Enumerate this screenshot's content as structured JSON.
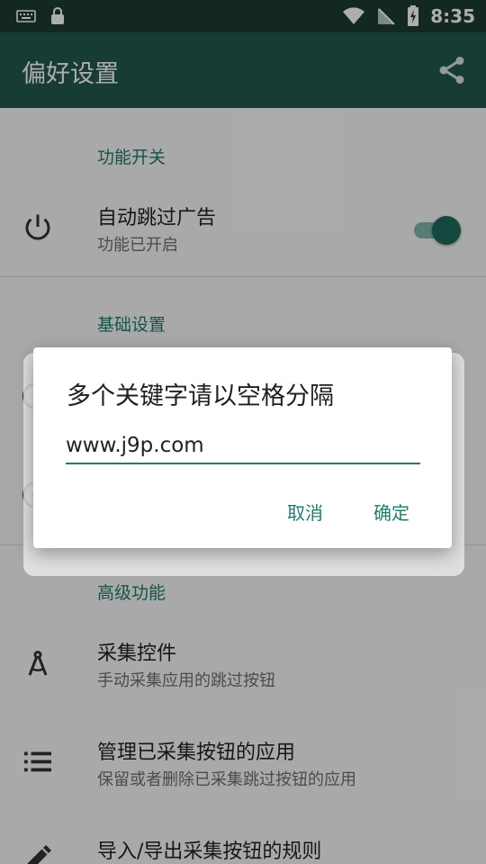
{
  "status_bar": {
    "time": "8:35",
    "icons": [
      "keyboard-icon",
      "lock-icon",
      "wifi-icon",
      "no-sim-icon",
      "battery-charging-icon"
    ]
  },
  "app_bar": {
    "title": "偏好设置",
    "share_icon": "share-icon"
  },
  "sections": {
    "feature_switch": {
      "header": "功能开关",
      "item": {
        "title": "自动跳过广告",
        "subtitle": "功能已开启",
        "icon": "power-icon",
        "switch_on": true
      }
    },
    "basic": {
      "header": "基础设置"
    },
    "advanced": {
      "header": "高级功能",
      "items": [
        {
          "title": "采集控件",
          "subtitle": "手动采集应用的跳过按钮",
          "icon": "compass-icon"
        },
        {
          "title": "管理已采集按钮的应用",
          "subtitle": "保留或者删除已采集跳过按钮的应用",
          "icon": "list-icon"
        },
        {
          "title": "导入/导出采集按钮的规则",
          "icon": "edit-icon"
        }
      ]
    }
  },
  "dialog": {
    "title": "多个关键字请以空格分隔",
    "input_value": "www.j9p.com",
    "cancel_label": "取消",
    "ok_label": "确定"
  },
  "colors": {
    "status_bar": "#1c3b33",
    "app_bar": "#22594d",
    "accent": "#1f7d6d"
  }
}
